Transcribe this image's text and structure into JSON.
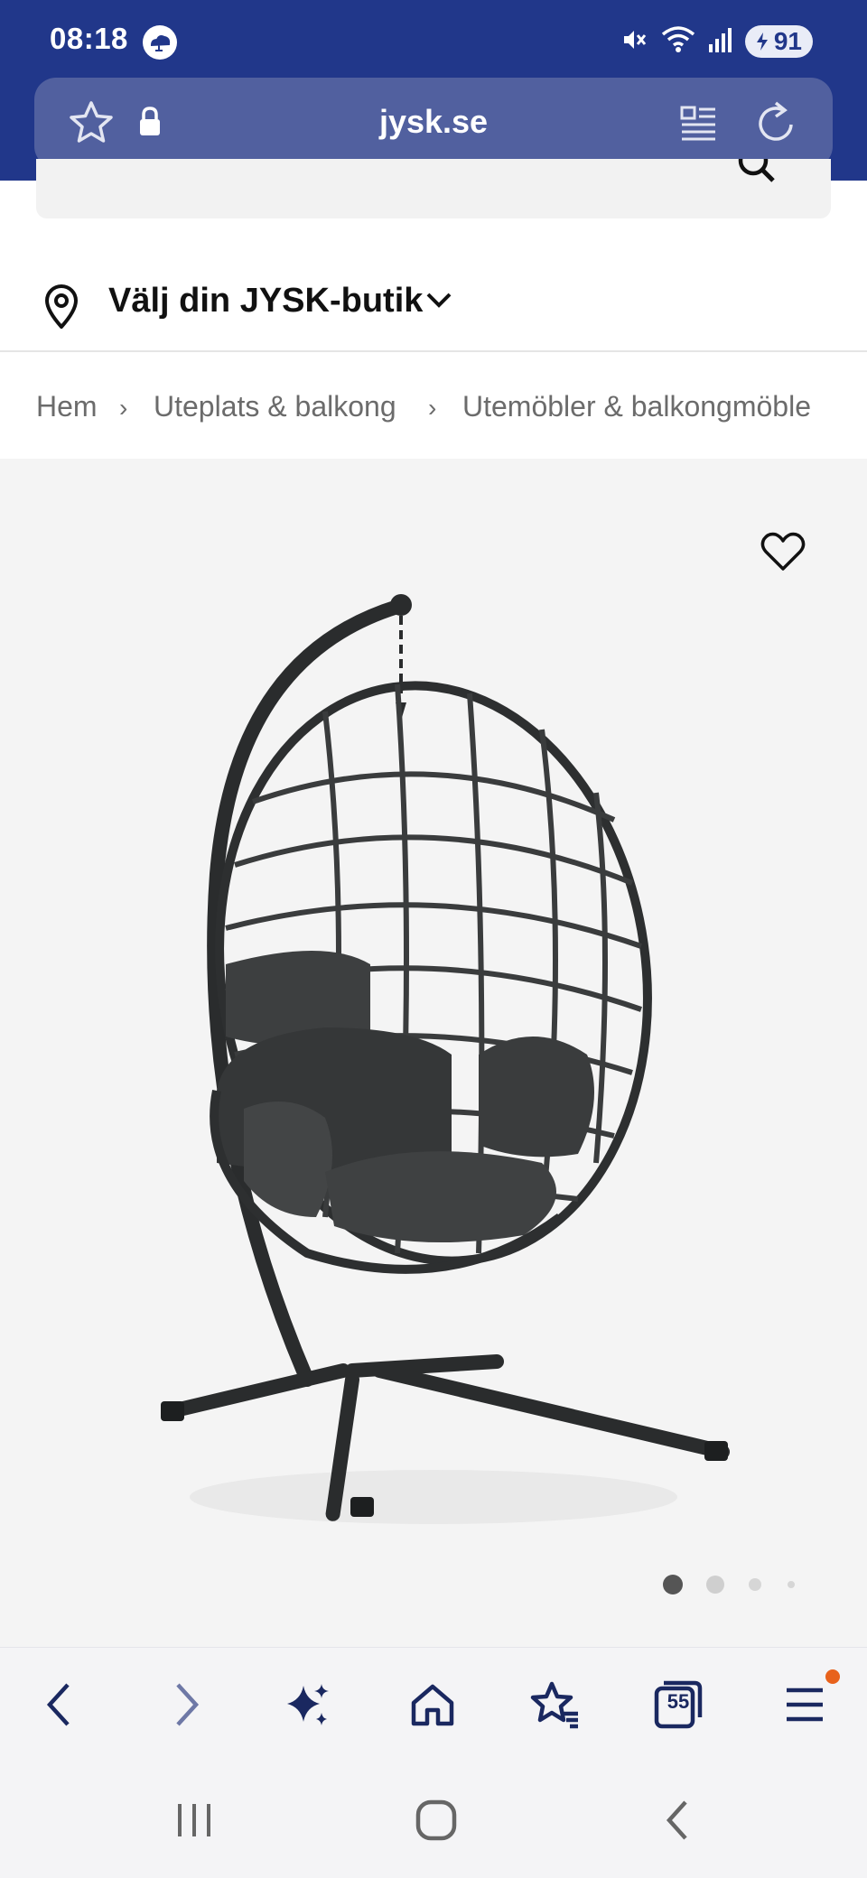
{
  "status_bar": {
    "time": "08:18",
    "battery": "91",
    "icons": [
      "cloud-icon",
      "mute-icon",
      "wifi-icon",
      "signal-icon",
      "battery-icon"
    ]
  },
  "browser": {
    "url_host": "jysk.se",
    "icons": [
      "star-icon",
      "lock-icon",
      "reader-icon",
      "reload-icon"
    ]
  },
  "store_selector": {
    "label": "Välj din JYSK-butik",
    "icons": [
      "location-pin-icon",
      "chevron-down-icon"
    ]
  },
  "breadcrumb": {
    "items": [
      "Hem",
      "Uteplats & balkong",
      "Utemöbler & balkongmöble"
    ],
    "separator": "›"
  },
  "gallery": {
    "image_alt": "Hängstol",
    "image_count": 4,
    "active_index": 0,
    "favorite_icon": "heart-icon"
  },
  "toolbar": {
    "tabs_count": "55",
    "icons": [
      "back-icon",
      "forward-icon",
      "ai-sparkle-icon",
      "home-icon",
      "bookmarks-icon",
      "tabs-icon",
      "menu-icon"
    ],
    "notification_color": "#e8621c"
  },
  "system_nav": {
    "icons": [
      "recents-icon",
      "home-circle-icon",
      "system-back-icon"
    ]
  },
  "colors": {
    "brand": "#21378a",
    "urlbar": "#51609f",
    "gallery_bg": "#f4f4f4",
    "icon_dark": "#1a2860"
  }
}
